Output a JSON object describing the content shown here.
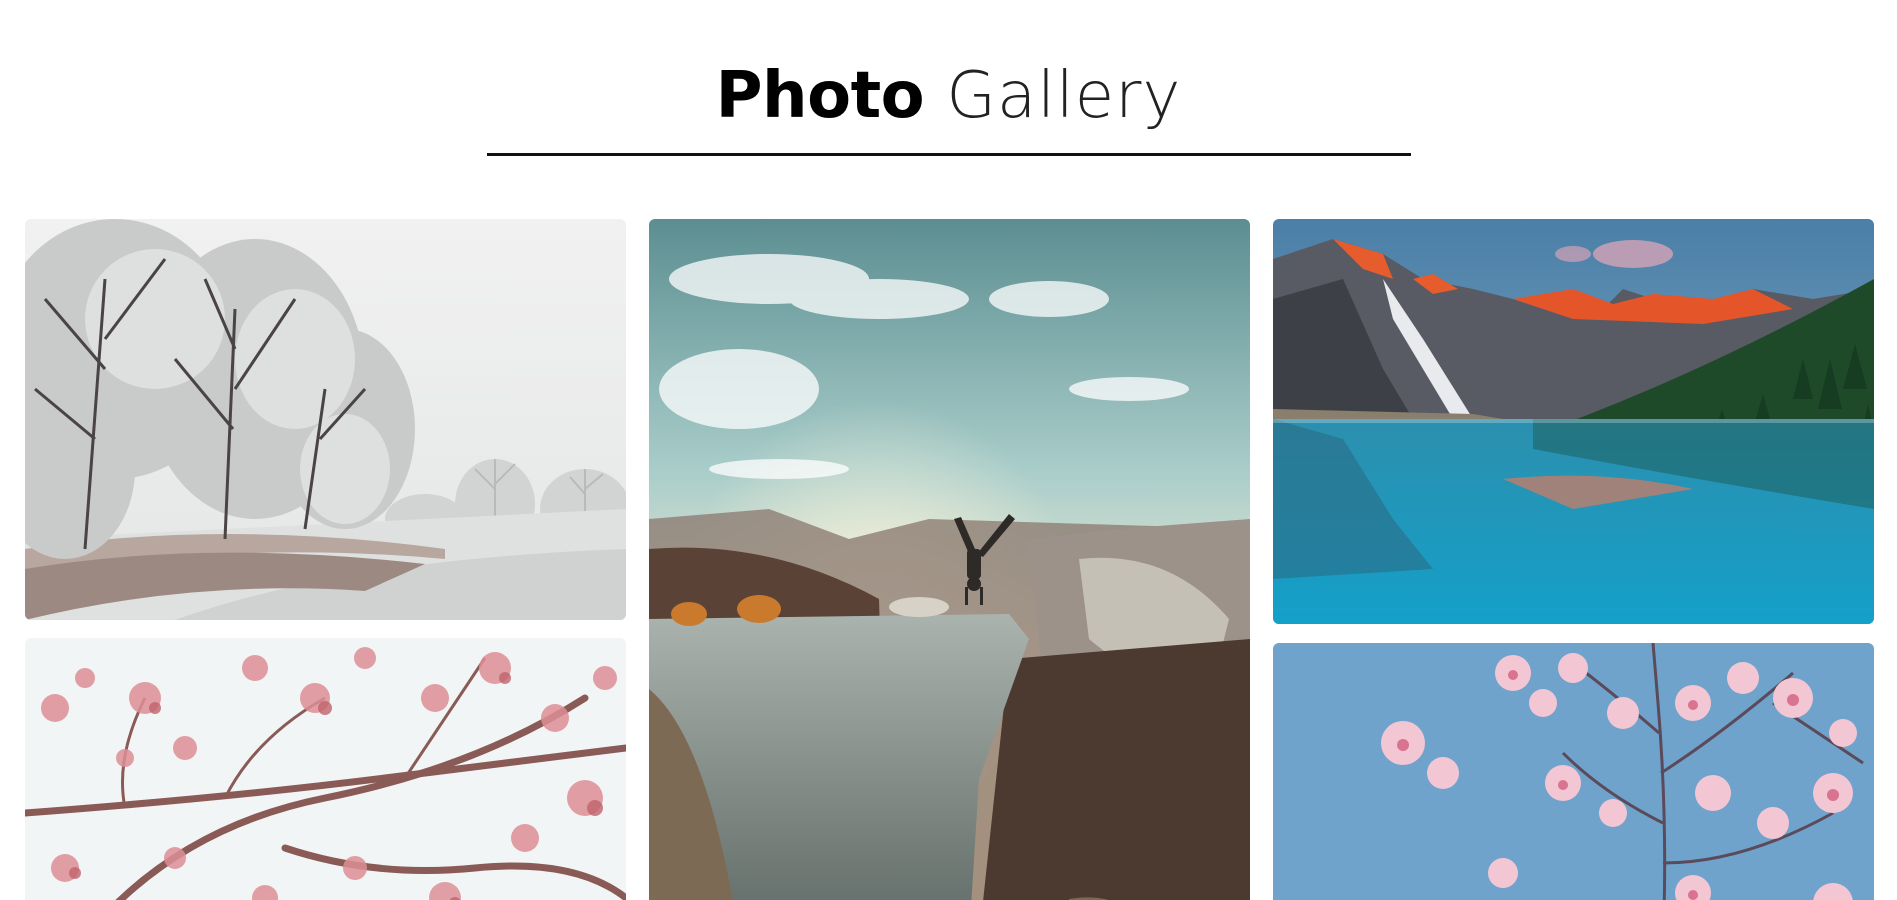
{
  "header": {
    "title_bold": "Photo",
    "title_light": "Gallery"
  },
  "gallery": {
    "photos": [
      {
        "subject": "snowy-trees-field"
      },
      {
        "subject": "pink-blossom-branches"
      },
      {
        "subject": "handstand-on-canyon-cliff"
      },
      {
        "subject": "mountain-lake-reflection"
      },
      {
        "subject": "cherry-blossoms-blue-sky"
      }
    ]
  },
  "colors": {
    "title_text": "#000000",
    "underline": "#111111",
    "background": "#ffffff"
  }
}
